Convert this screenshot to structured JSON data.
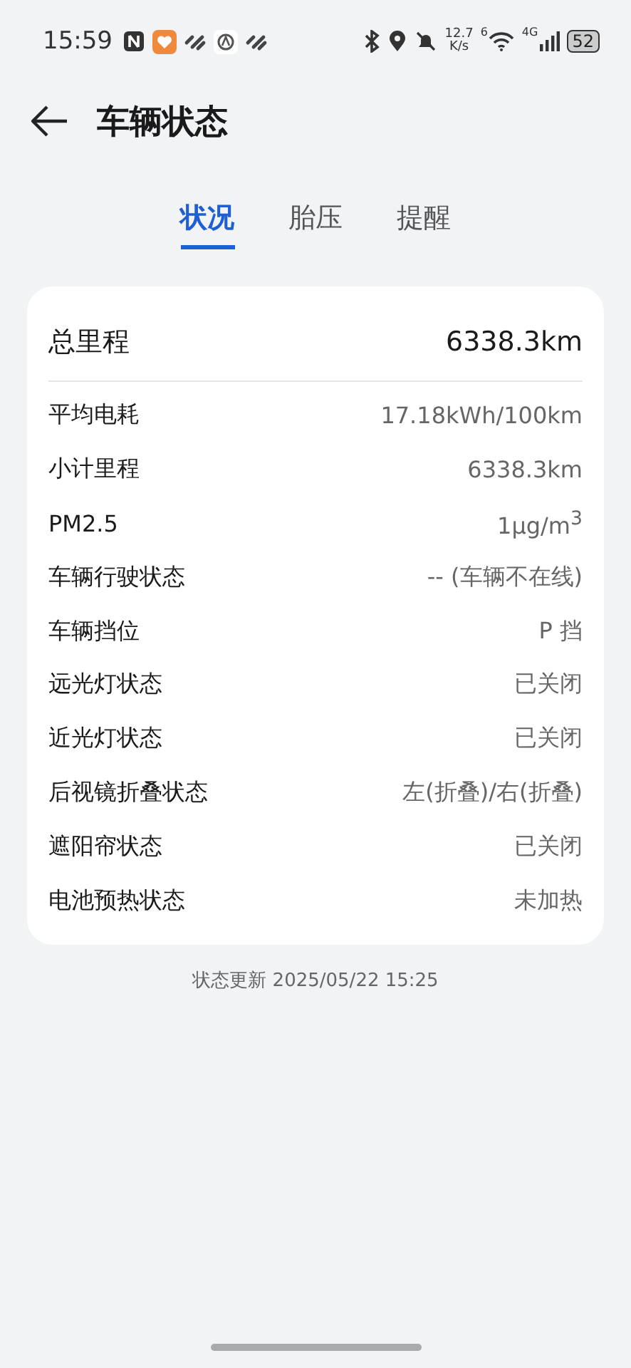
{
  "status_bar": {
    "time": "15:59",
    "net_speed": "12.7",
    "net_unit": "K/s",
    "wifi_label": "6",
    "cell_label": "4G",
    "battery": "52"
  },
  "header": {
    "title": "车辆状态"
  },
  "tabs": [
    {
      "label": "状况",
      "selected": true
    },
    {
      "label": "胎压",
      "selected": false
    },
    {
      "label": "提醒",
      "selected": false
    }
  ],
  "summary": {
    "label": "总里程",
    "value": "6338.3km"
  },
  "rows": [
    {
      "label": "平均电耗",
      "value": "17.18kWh/100km"
    },
    {
      "label": "小计里程",
      "value": "6338.3km"
    },
    {
      "label": "PM2.5",
      "value": "1μg/m$^{3}$"
    },
    {
      "label": "车辆行驶状态",
      "value": "-- (车辆不在线)"
    },
    {
      "label": "车辆挡位",
      "value": "P 挡"
    },
    {
      "label": "远光灯状态",
      "value": "已关闭"
    },
    {
      "label": "近光灯状态",
      "value": "已关闭"
    },
    {
      "label": "后视镜折叠状态",
      "value": "左(折叠)/右(折叠)"
    },
    {
      "label": "遮阳帘状态",
      "value": "已关闭"
    },
    {
      "label": "电池预热状态",
      "value": "未加热"
    }
  ],
  "footer": "状态更新 2025/05/22 15:25"
}
